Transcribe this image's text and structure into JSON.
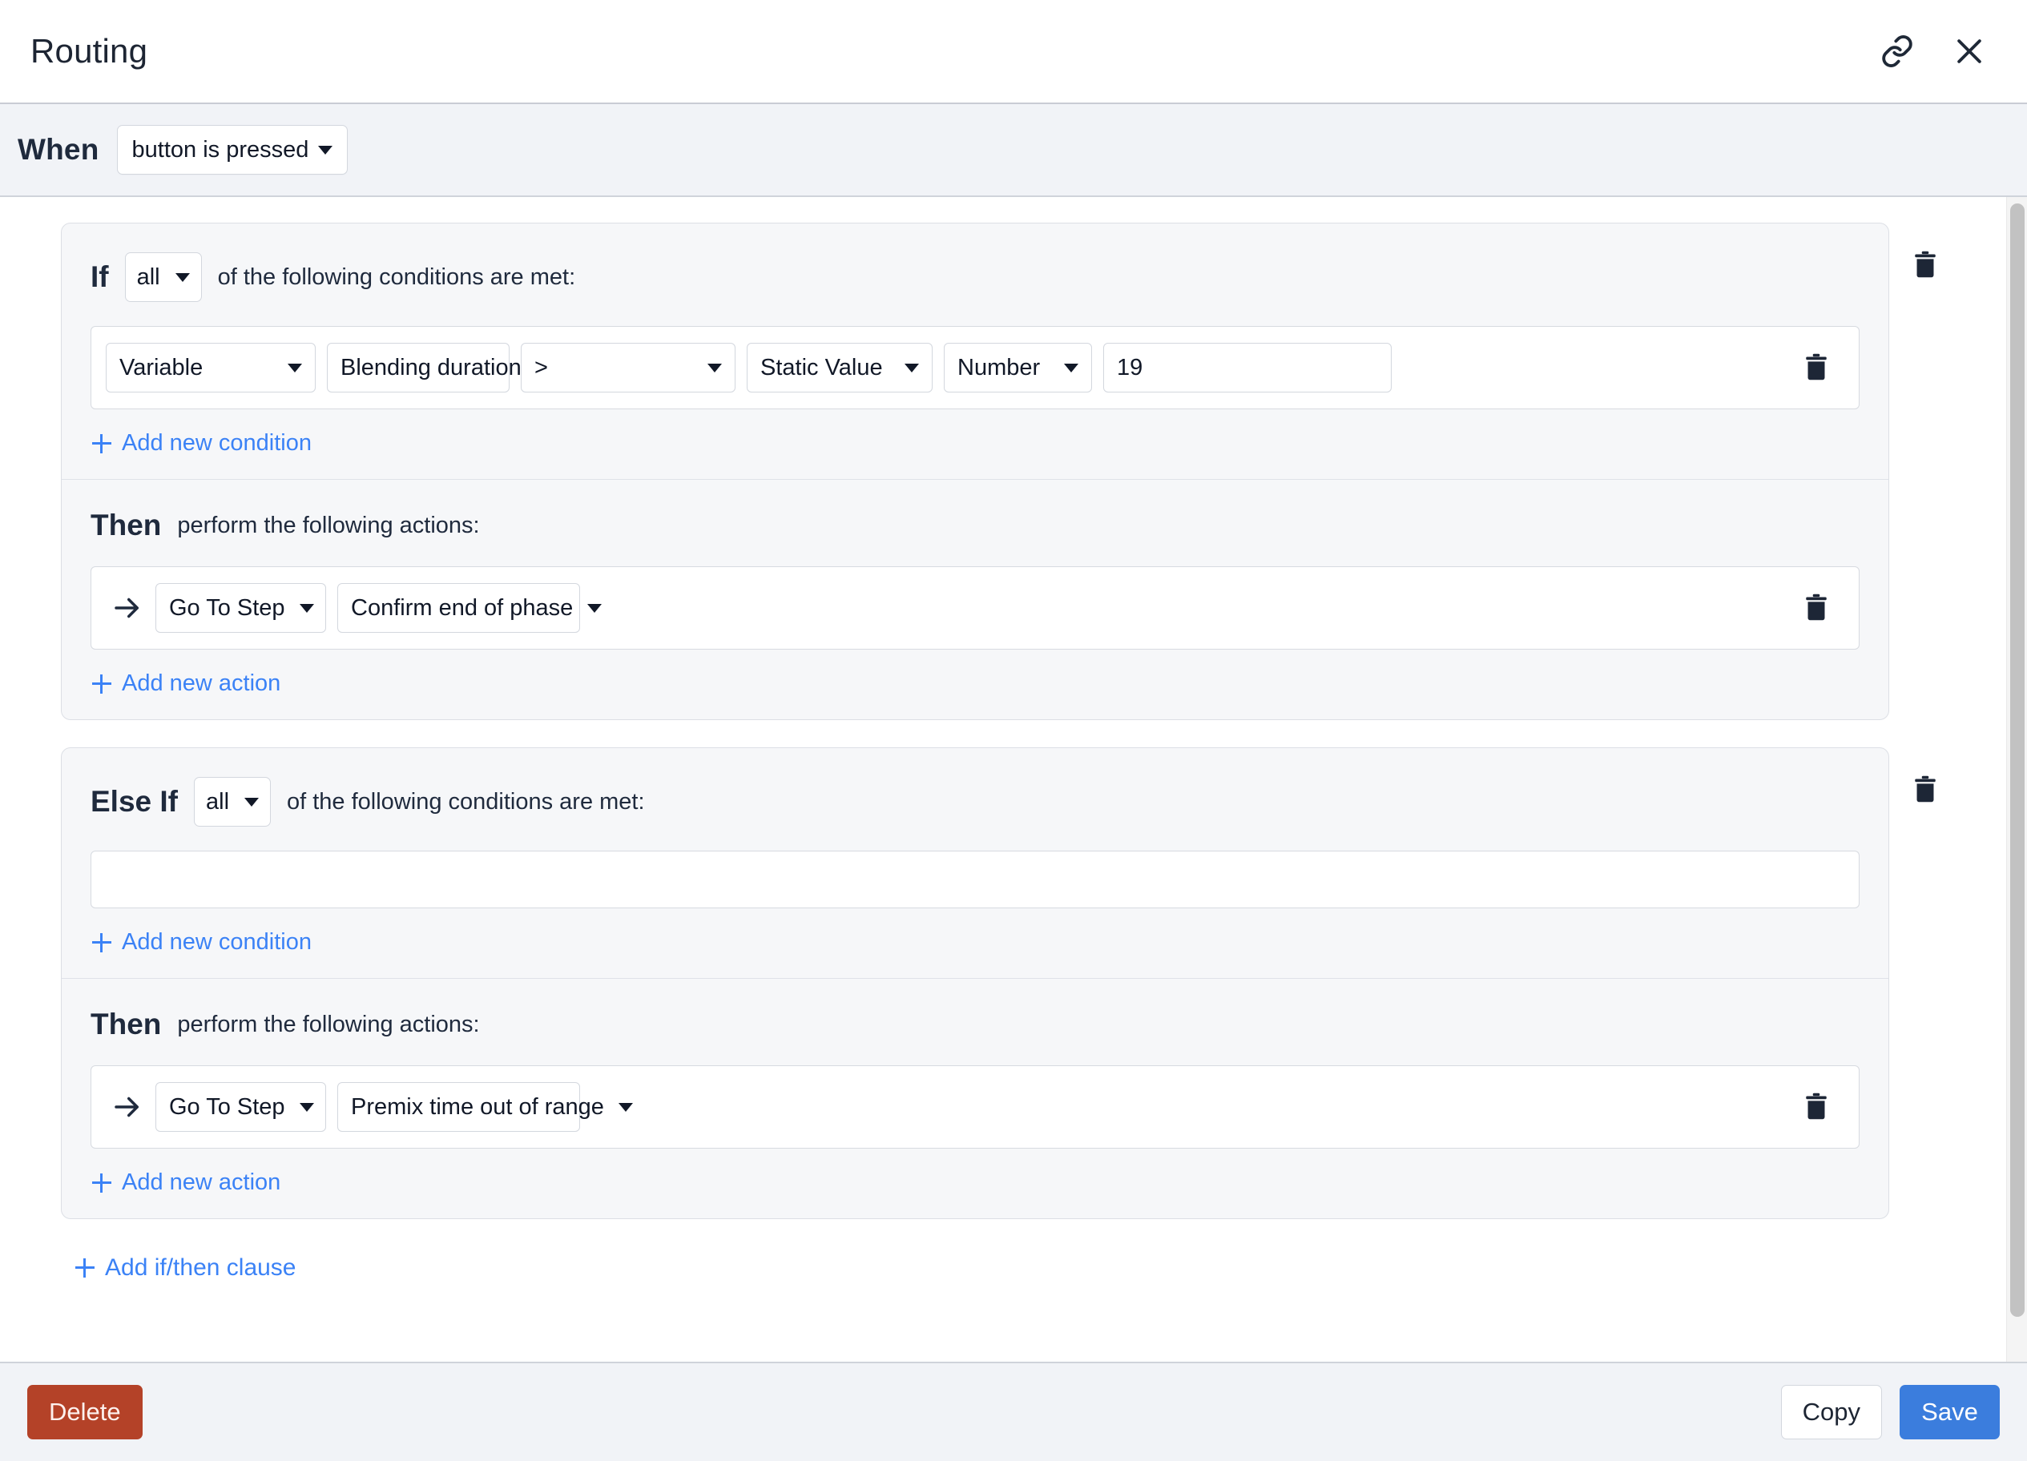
{
  "header": {
    "title": "Routing",
    "link_icon": "link-icon",
    "close_icon": "close-icon"
  },
  "when": {
    "label": "When",
    "trigger": "button is pressed"
  },
  "clauses": [
    {
      "keyword": "If",
      "match": "all",
      "cond_suffix": "of the following conditions are met:",
      "conditions": [
        {
          "source": "Variable",
          "variable": "Blending duration",
          "operator": ">",
          "value_type": "Static Value",
          "data_type": "Number",
          "value": "19"
        }
      ],
      "add_condition_label": "Add new condition",
      "then_keyword": "Then",
      "then_suffix": "perform the following actions:",
      "actions": [
        {
          "action": "Go To Step",
          "target": "Confirm end of phase"
        }
      ],
      "add_action_label": "Add new action"
    },
    {
      "keyword": "Else If",
      "match": "all",
      "cond_suffix": "of the following conditions are met:",
      "conditions": [],
      "add_condition_label": "Add new condition",
      "then_keyword": "Then",
      "then_suffix": "perform the following actions:",
      "actions": [
        {
          "action": "Go To Step",
          "target": "Premix time out of range"
        }
      ],
      "add_action_label": "Add new action"
    }
  ],
  "add_clause_label": "Add if/then clause",
  "footer": {
    "delete_label": "Delete",
    "copy_label": "Copy",
    "save_label": "Save"
  },
  "colors": {
    "accent_blue": "#3b82f6",
    "save_blue": "#3b7ddd",
    "delete_red": "#b44228",
    "panel_bg": "#f6f7f9",
    "chrome_bg": "#f1f3f7"
  }
}
